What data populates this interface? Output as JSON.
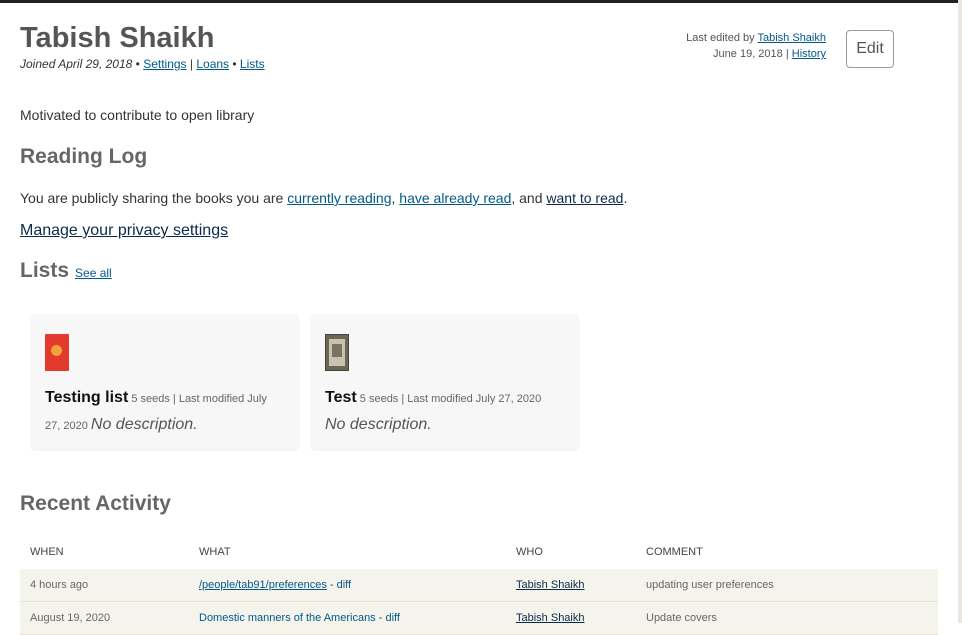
{
  "profile": {
    "name": "Tabish Shaikh",
    "joined": "Joined April 29, 2018",
    "bullet1": " • ",
    "settings": "Settings",
    "sep": " | ",
    "loans": "Loans",
    "bullet2": " • ",
    "lists": "Lists",
    "bio": "Motivated to contribute to open library"
  },
  "edit_info": {
    "prefix": "Last edited by ",
    "editor": "Tabish Shaikh",
    "date": "June 19, 2018",
    "sep": " | ",
    "history": "History",
    "edit_button": "Edit"
  },
  "reading_log": {
    "heading": "Reading Log",
    "text_before": "You are publicly sharing the books you are ",
    "link_current": "currently reading",
    "comma": ", ",
    "link_read": "have already read",
    "and": ", and ",
    "link_want": "want to read",
    "period": ".",
    "privacy_link": "Manage your privacy settings"
  },
  "lists_section": {
    "heading": "Lists",
    "see_all": "See all",
    "cards": [
      {
        "title": "Testing list",
        "meta": "5 seeds | Last modified July 27, 2020",
        "description": "No description.",
        "cover_color": "#e23a2d"
      },
      {
        "title": "Test",
        "meta": "5 seeds | Last modified July 27, 2020",
        "description": "No description.",
        "cover_color": "#6d6652"
      }
    ]
  },
  "recent_activity": {
    "heading": "Recent Activity",
    "columns": [
      "WHEN",
      "WHAT",
      "WHO",
      "COMMENT"
    ],
    "rows": [
      {
        "when": "4 hours ago",
        "what": "/people/tab91/preferences",
        "diff": " - diff",
        "who": "Tabish Shaikh",
        "comment": "updating user preferences"
      },
      {
        "when": "August 19, 2020",
        "what": "Domestic manners of the Americans",
        "diff": " - diff",
        "who": "Tabish Shaikh",
        "comment": "Update covers"
      }
    ]
  }
}
